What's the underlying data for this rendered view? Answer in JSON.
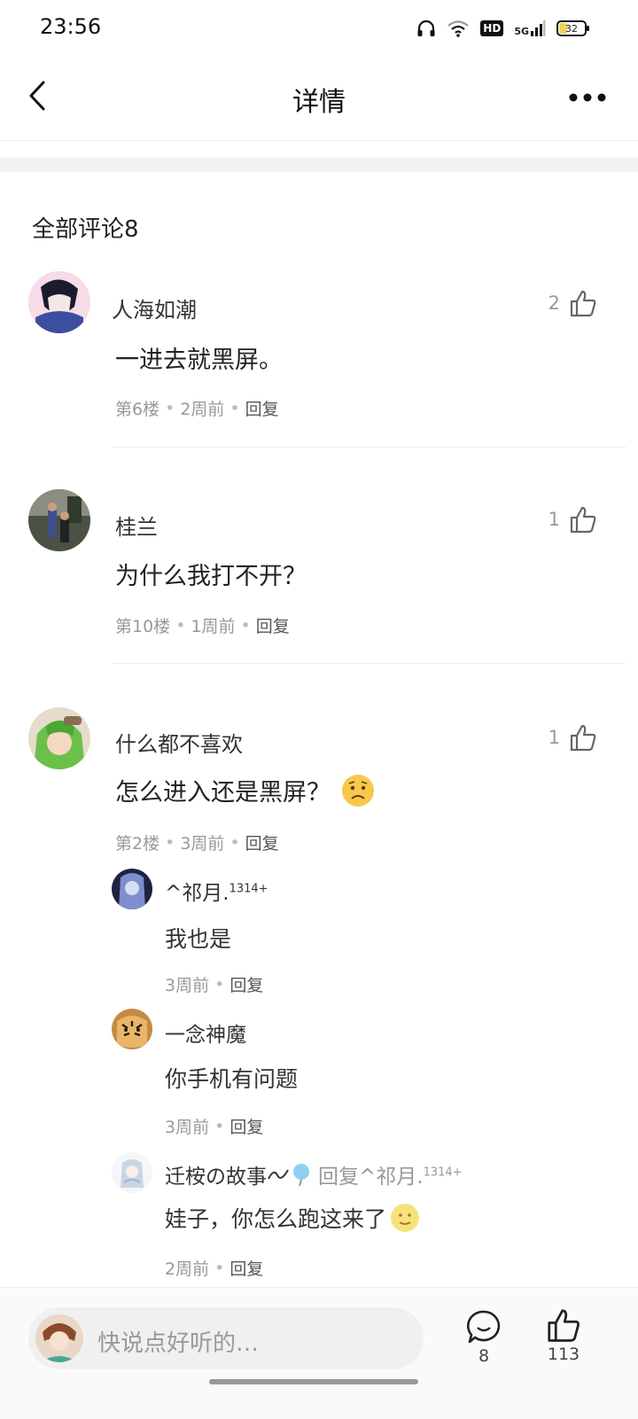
{
  "status_bar": {
    "time": "23:56",
    "hd": "HD",
    "network": "5G",
    "battery": "32"
  },
  "nav": {
    "title": "详情"
  },
  "comments_header": "全部评论8",
  "comments": [
    {
      "author": "人海如潮",
      "content": "一进去就黑屏。",
      "floor": "第6楼",
      "time": "2周前",
      "reply": "回复",
      "likes": "2"
    },
    {
      "author": "桂兰",
      "content": "为什么我打不开？",
      "floor": "第10楼",
      "time": "1周前",
      "reply": "回复",
      "likes": "1"
    },
    {
      "author": "什么都不喜欢",
      "content": "怎么进入还是黑屏？",
      "floor": "第2楼",
      "time": "3周前",
      "reply": "回复",
      "likes": "1"
    }
  ],
  "replies": [
    {
      "author": "^祁月.",
      "author_sup": "1314+",
      "content": "我也是",
      "time": "3周前",
      "reply": "回复"
    },
    {
      "author": "一念神魔",
      "content": "你手机有问题",
      "time": "3周前",
      "reply": "回复"
    },
    {
      "author": "迁桉の故事",
      "reply_to": "回复^祁月.",
      "reply_to_sup": "1314+",
      "content": "娃子，你怎么跑这来了",
      "time": "2周前",
      "reply": "回复"
    }
  ],
  "bottom_bar": {
    "placeholder": "快说点好听的…",
    "comment_count": "8",
    "like_count": "113"
  },
  "icons": {
    "back": "back-arrow-icon",
    "more": "more-dots-icon",
    "like": "thumbs-up-icon",
    "comment": "comment-bubble-icon",
    "emoji_worried": "worried-face-emoji",
    "emoji_smile": "moon-face-emoji"
  }
}
